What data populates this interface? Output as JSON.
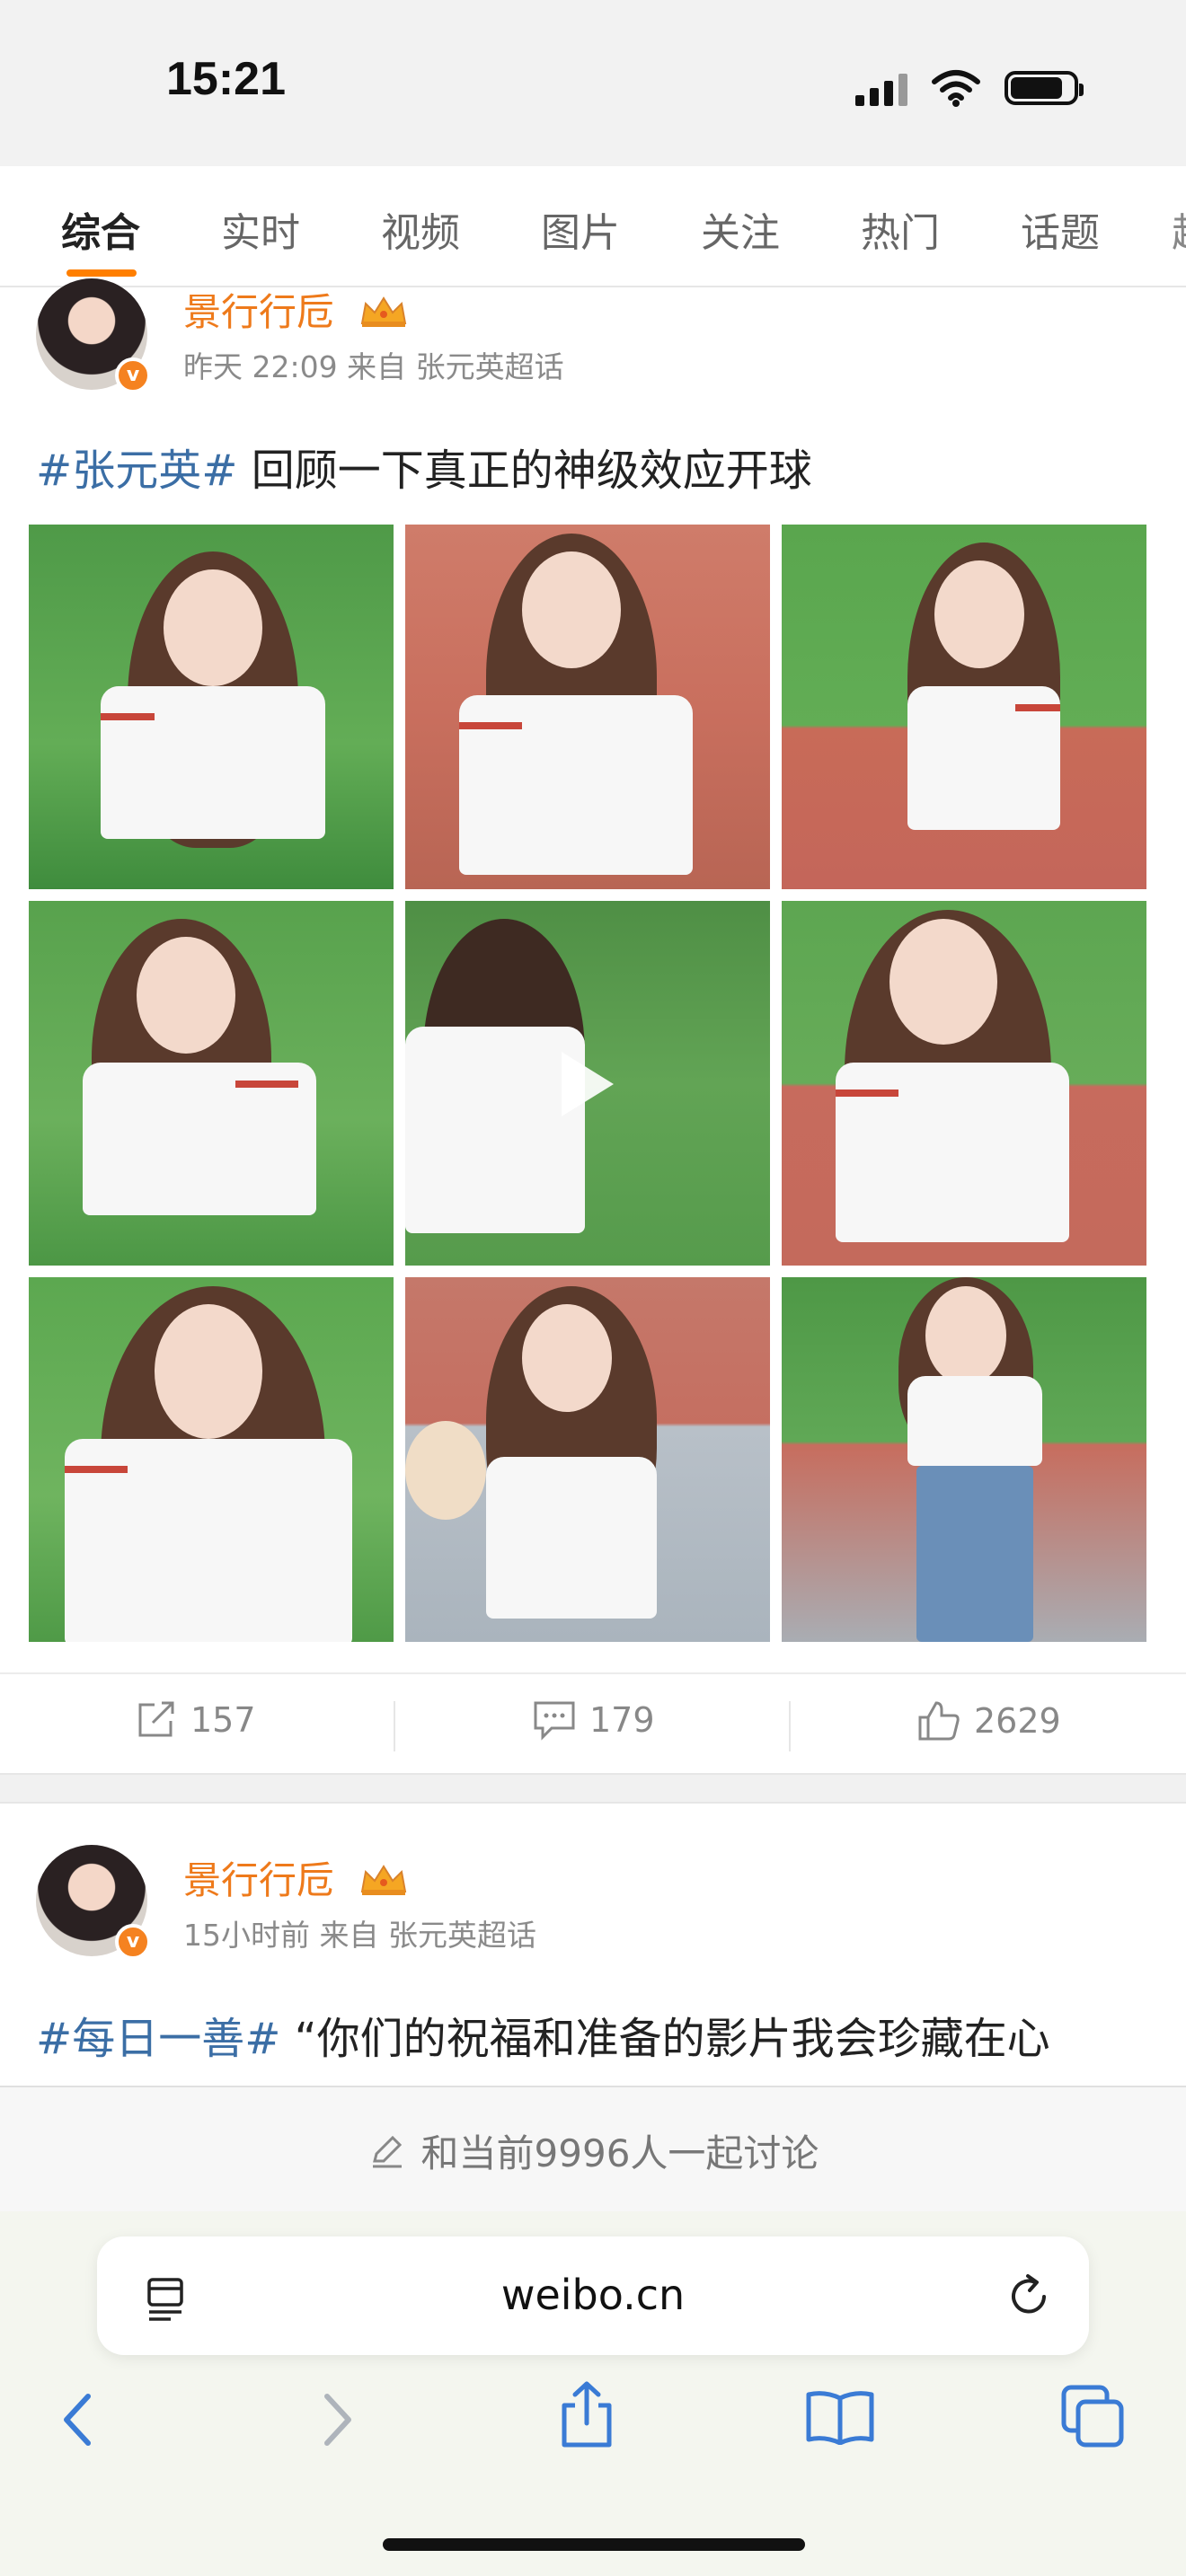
{
  "status_bar": {
    "time": "15:21"
  },
  "tabs": [
    {
      "label": "综合",
      "active": true
    },
    {
      "label": "实时"
    },
    {
      "label": "视频"
    },
    {
      "label": "图片"
    },
    {
      "label": "关注"
    },
    {
      "label": "热门"
    },
    {
      "label": "话题"
    }
  ],
  "posts": [
    {
      "username": "景行行卮",
      "meta": "昨天 22:09 来自 张元英超话",
      "hashtag": "#张元英#",
      "text": " 回顾一下真正的神级效应开球",
      "reposts": "157",
      "comments": "179",
      "likes": "2629"
    },
    {
      "username": "景行行卮",
      "meta": "15小时前 来自 张元英超话",
      "hashtag": "#每日一善#",
      "text": " “你们的祝福和准备的影片我会珍藏在心"
    }
  ],
  "discuss_bar": {
    "label": "和当前9996人一起讨论"
  },
  "browser": {
    "url": "weibo.cn"
  },
  "colors": {
    "accent": "#ff7f00",
    "username": "#ee7a1b",
    "hashtag": "#3b6ea5"
  },
  "icons": [
    "signal-icon",
    "wifi-icon",
    "battery-icon",
    "crown-icon",
    "repost-icon",
    "comment-icon",
    "like-icon",
    "pencil-icon",
    "reader-icon",
    "reload-icon",
    "back-icon",
    "forward-icon",
    "share-icon",
    "bookmarks-icon",
    "tabs-icon",
    "play-icon"
  ]
}
